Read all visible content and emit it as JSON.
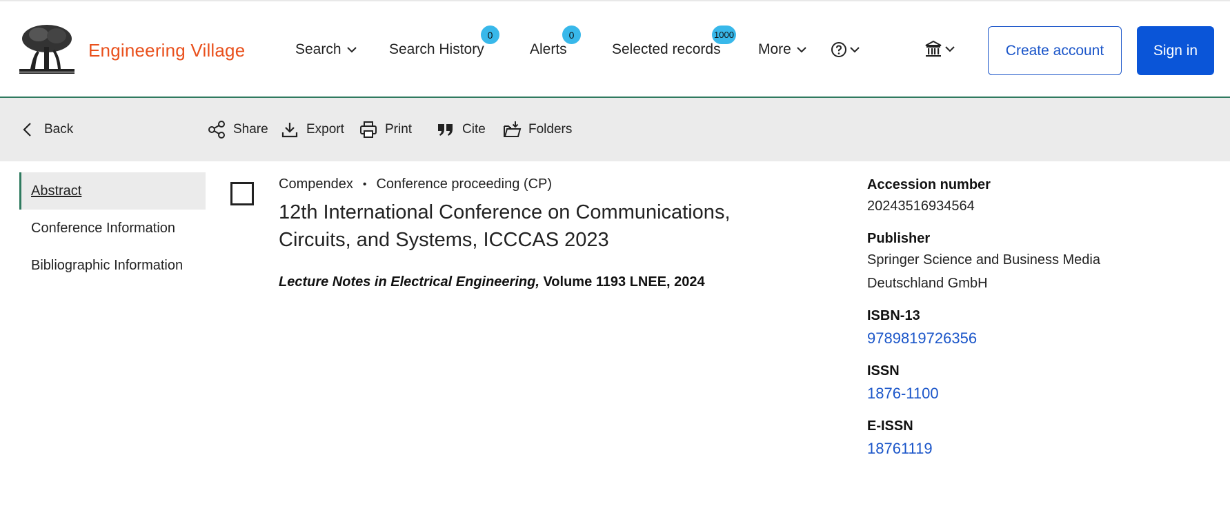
{
  "header": {
    "brand": "Engineering Village",
    "nav": {
      "search": "Search",
      "search_history": "Search History",
      "search_history_count": "0",
      "alerts": "Alerts",
      "alerts_count": "0",
      "selected_records": "Selected records",
      "selected_records_count": "1000",
      "more": "More"
    },
    "create_account": "Create account",
    "sign_in": "Sign in"
  },
  "toolbar": {
    "back": "Back",
    "share": "Share",
    "export": "Export",
    "print": "Print",
    "cite": "Cite",
    "folders": "Folders"
  },
  "sidenav": {
    "items": [
      "Abstract",
      "Conference Information",
      "Bibliographic Information"
    ]
  },
  "record": {
    "database": "Compendex",
    "doc_type": "Conference proceeding (CP)",
    "title": "12th International Conference on Communications, Circuits, and Systems, ICCCAS 2023",
    "source_italic": "Lecture Notes in Electrical Engineering,",
    "source_rest": "Volume 1193 LNEE, 2024"
  },
  "details": {
    "accession_label": "Accession number",
    "accession_value": "20243516934564",
    "publisher_label": "Publisher",
    "publisher_line1": "Springer Science and Business Media",
    "publisher_line2": "Deutschland GmbH",
    "isbn_label": "ISBN-13",
    "isbn_value": "9789819726356",
    "issn_label": "ISSN",
    "issn_value": "1876-1100",
    "eissn_label": "E-ISSN",
    "eissn_value": "18761119"
  },
  "colors": {
    "brand": "#e9501c",
    "primary": "#0a55d8",
    "badge": "#38b8ea",
    "accent_green": "#2f7a5f"
  }
}
